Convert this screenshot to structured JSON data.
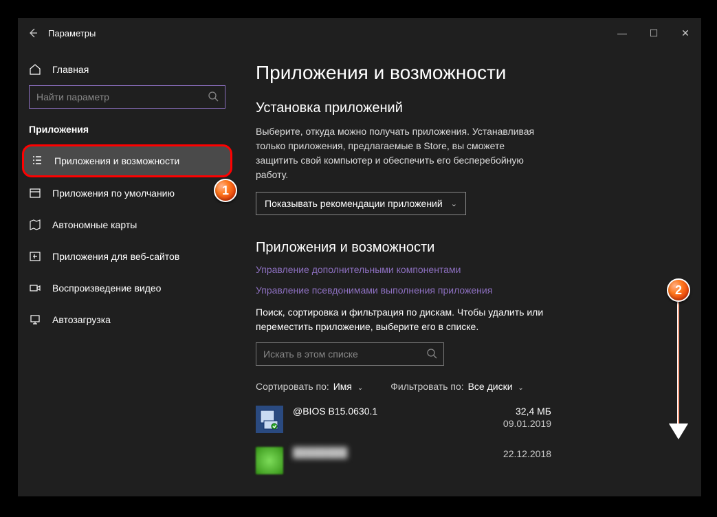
{
  "window": {
    "title": "Параметры"
  },
  "win_controls": {
    "min": "—",
    "max": "☐",
    "close": "✕"
  },
  "sidebar": {
    "home_label": "Главная",
    "search_placeholder": "Найти параметр",
    "category": "Приложения",
    "items": [
      {
        "label": "Приложения и возможности"
      },
      {
        "label": "Приложения по умолчанию"
      },
      {
        "label": "Автономные карты"
      },
      {
        "label": "Приложения для веб-сайтов"
      },
      {
        "label": "Воспроизведение видео"
      },
      {
        "label": "Автозагрузка"
      }
    ]
  },
  "main": {
    "page_title": "Приложения и возможности",
    "install_section": {
      "title": "Установка приложений",
      "desc": "Выберите, откуда можно получать приложения. Устанавливая только приложения, предлагаемые в Store, вы сможете защитить свой компьютер и обеспечить его бесперебойную работу.",
      "combo_label": "Показывать рекомендации приложений"
    },
    "apps_section": {
      "title": "Приложения и возможности",
      "link_optional": "Управление дополнительными компонентами",
      "link_alias": "Управление псевдонимами выполнения приложения",
      "desc": "Поиск, сортировка и фильтрация по дискам. Чтобы удалить или переместить приложение, выберите его в списке.",
      "search_placeholder": "Искать в этом списке",
      "sort_label": "Сортировать по:",
      "sort_value": "Имя",
      "filter_label": "Фильтровать по:",
      "filter_value": "Все диски",
      "apps": [
        {
          "name": "@BIOS B15.0630.1",
          "size": "32,4 МБ",
          "date": "09.01.2019"
        },
        {
          "name": "████████",
          "size": "",
          "date": "22.12.2018"
        }
      ]
    }
  },
  "annotations": {
    "b1": "1",
    "b2": "2"
  }
}
